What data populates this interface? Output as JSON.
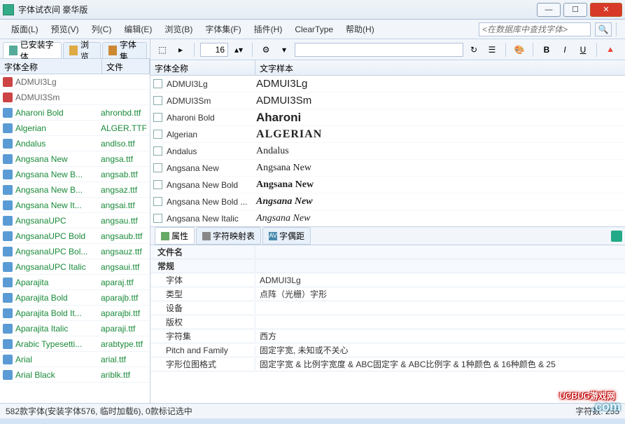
{
  "window": {
    "title": "字体试衣间 豪华版"
  },
  "menu": {
    "items": [
      "版面(L)",
      "预览(V)",
      "列(C)",
      "编辑(E)",
      "浏览(B)",
      "字体集(F)",
      "插件(H)",
      "ClearType",
      "帮助(H)"
    ],
    "search_placeholder": "<在数据库中查找字体>"
  },
  "toolbar": {
    "size": "16"
  },
  "left_tabs": {
    "installed": "已安装字体",
    "browse": "浏览",
    "sets": "字体集"
  },
  "left_columns": {
    "name": "字体全称",
    "file": "文件"
  },
  "left_rows": [
    {
      "icon": "a",
      "name": "ADMUI3Lg",
      "file": "",
      "grey": true
    },
    {
      "icon": "a",
      "name": "ADMUI3Sm",
      "file": "",
      "grey": true
    },
    {
      "icon": "o",
      "name": "Aharoni Bold",
      "file": "ahronbd.ttf"
    },
    {
      "icon": "o",
      "name": "Algerian",
      "file": "ALGER.TTF"
    },
    {
      "icon": "o",
      "name": "Andalus",
      "file": "andlso.ttf"
    },
    {
      "icon": "o",
      "name": "Angsana New",
      "file": "angsa.ttf"
    },
    {
      "icon": "o",
      "name": "Angsana New B...",
      "file": "angsab.ttf"
    },
    {
      "icon": "o",
      "name": "Angsana New B...",
      "file": "angsaz.ttf"
    },
    {
      "icon": "o",
      "name": "Angsana New It...",
      "file": "angsai.ttf"
    },
    {
      "icon": "o",
      "name": "AngsanaUPC",
      "file": "angsau.ttf"
    },
    {
      "icon": "o",
      "name": "AngsanaUPC Bold",
      "file": "angsaub.ttf"
    },
    {
      "icon": "o",
      "name": "AngsanaUPC Bol...",
      "file": "angsauz.ttf"
    },
    {
      "icon": "o",
      "name": "AngsanaUPC Italic",
      "file": "angsaui.ttf"
    },
    {
      "icon": "o",
      "name": "Aparajita",
      "file": "aparaj.ttf"
    },
    {
      "icon": "o",
      "name": "Aparajita Bold",
      "file": "aparajb.ttf"
    },
    {
      "icon": "o",
      "name": "Aparajita Bold It...",
      "file": "aparajbi.ttf"
    },
    {
      "icon": "o",
      "name": "Aparajita Italic",
      "file": "aparaji.ttf"
    },
    {
      "icon": "o",
      "name": "Arabic Typesetti...",
      "file": "arabtype.ttf"
    },
    {
      "icon": "o",
      "name": "Arial",
      "file": "arial.ttf"
    },
    {
      "icon": "o",
      "name": "Arial Black",
      "file": "ariblk.ttf"
    }
  ],
  "right_columns": {
    "name": "字体全称",
    "sample": "文字样本"
  },
  "right_rows": [
    {
      "name": "ADMUI3Lg",
      "sample": "ADMUI3Lg",
      "cls": ""
    },
    {
      "name": "ADMUI3Sm",
      "sample": "ADMUI3Sm",
      "cls": ""
    },
    {
      "name": "Aharoni Bold",
      "sample": "Aharoni",
      "cls": "bold"
    },
    {
      "name": "Algerian",
      "sample": "ALGERIAN",
      "cls": "algerian bold"
    },
    {
      "name": "Andalus",
      "sample": "Andalus",
      "cls": "serif"
    },
    {
      "name": "Angsana New",
      "sample": "Angsana New",
      "cls": "serif"
    },
    {
      "name": "Angsana New Bold",
      "sample": "Angsana New",
      "cls": "serif bold"
    },
    {
      "name": "Angsana New Bold ...",
      "sample": "Angsana New",
      "cls": "serif bold italic"
    },
    {
      "name": "Angsana New Italic",
      "sample": "Angsana New",
      "cls": "serif italic"
    }
  ],
  "bottom_tabs": {
    "props": "属性",
    "charmap": "字符映射表",
    "kerning": "字偶距"
  },
  "props": {
    "filename_label": "文件名",
    "general_label": "常规",
    "rows": [
      {
        "label": "字体",
        "value": "ADMUI3Lg"
      },
      {
        "label": "类型",
        "value": "点阵（光栅）字形"
      },
      {
        "label": "设备",
        "value": ""
      },
      {
        "label": "版权",
        "value": ""
      },
      {
        "label": "字符集",
        "value": "西方"
      },
      {
        "label": "Pitch and Family",
        "value": "固定字宽, 未知或不关心"
      },
      {
        "label": "字形位图格式",
        "value": "固定字宽 & 比例字宽度 & ABC固定字 & ABC比例字 & 1种颜色 & 16种颜色 & 25"
      }
    ]
  },
  "status": {
    "left": "582款字体(安装字体576, 临时加载6), 0款标记选中",
    "right": "字符数: 255"
  },
  "watermark": {
    "line1": "UCBUG游戏网",
    "line2": ".com"
  }
}
